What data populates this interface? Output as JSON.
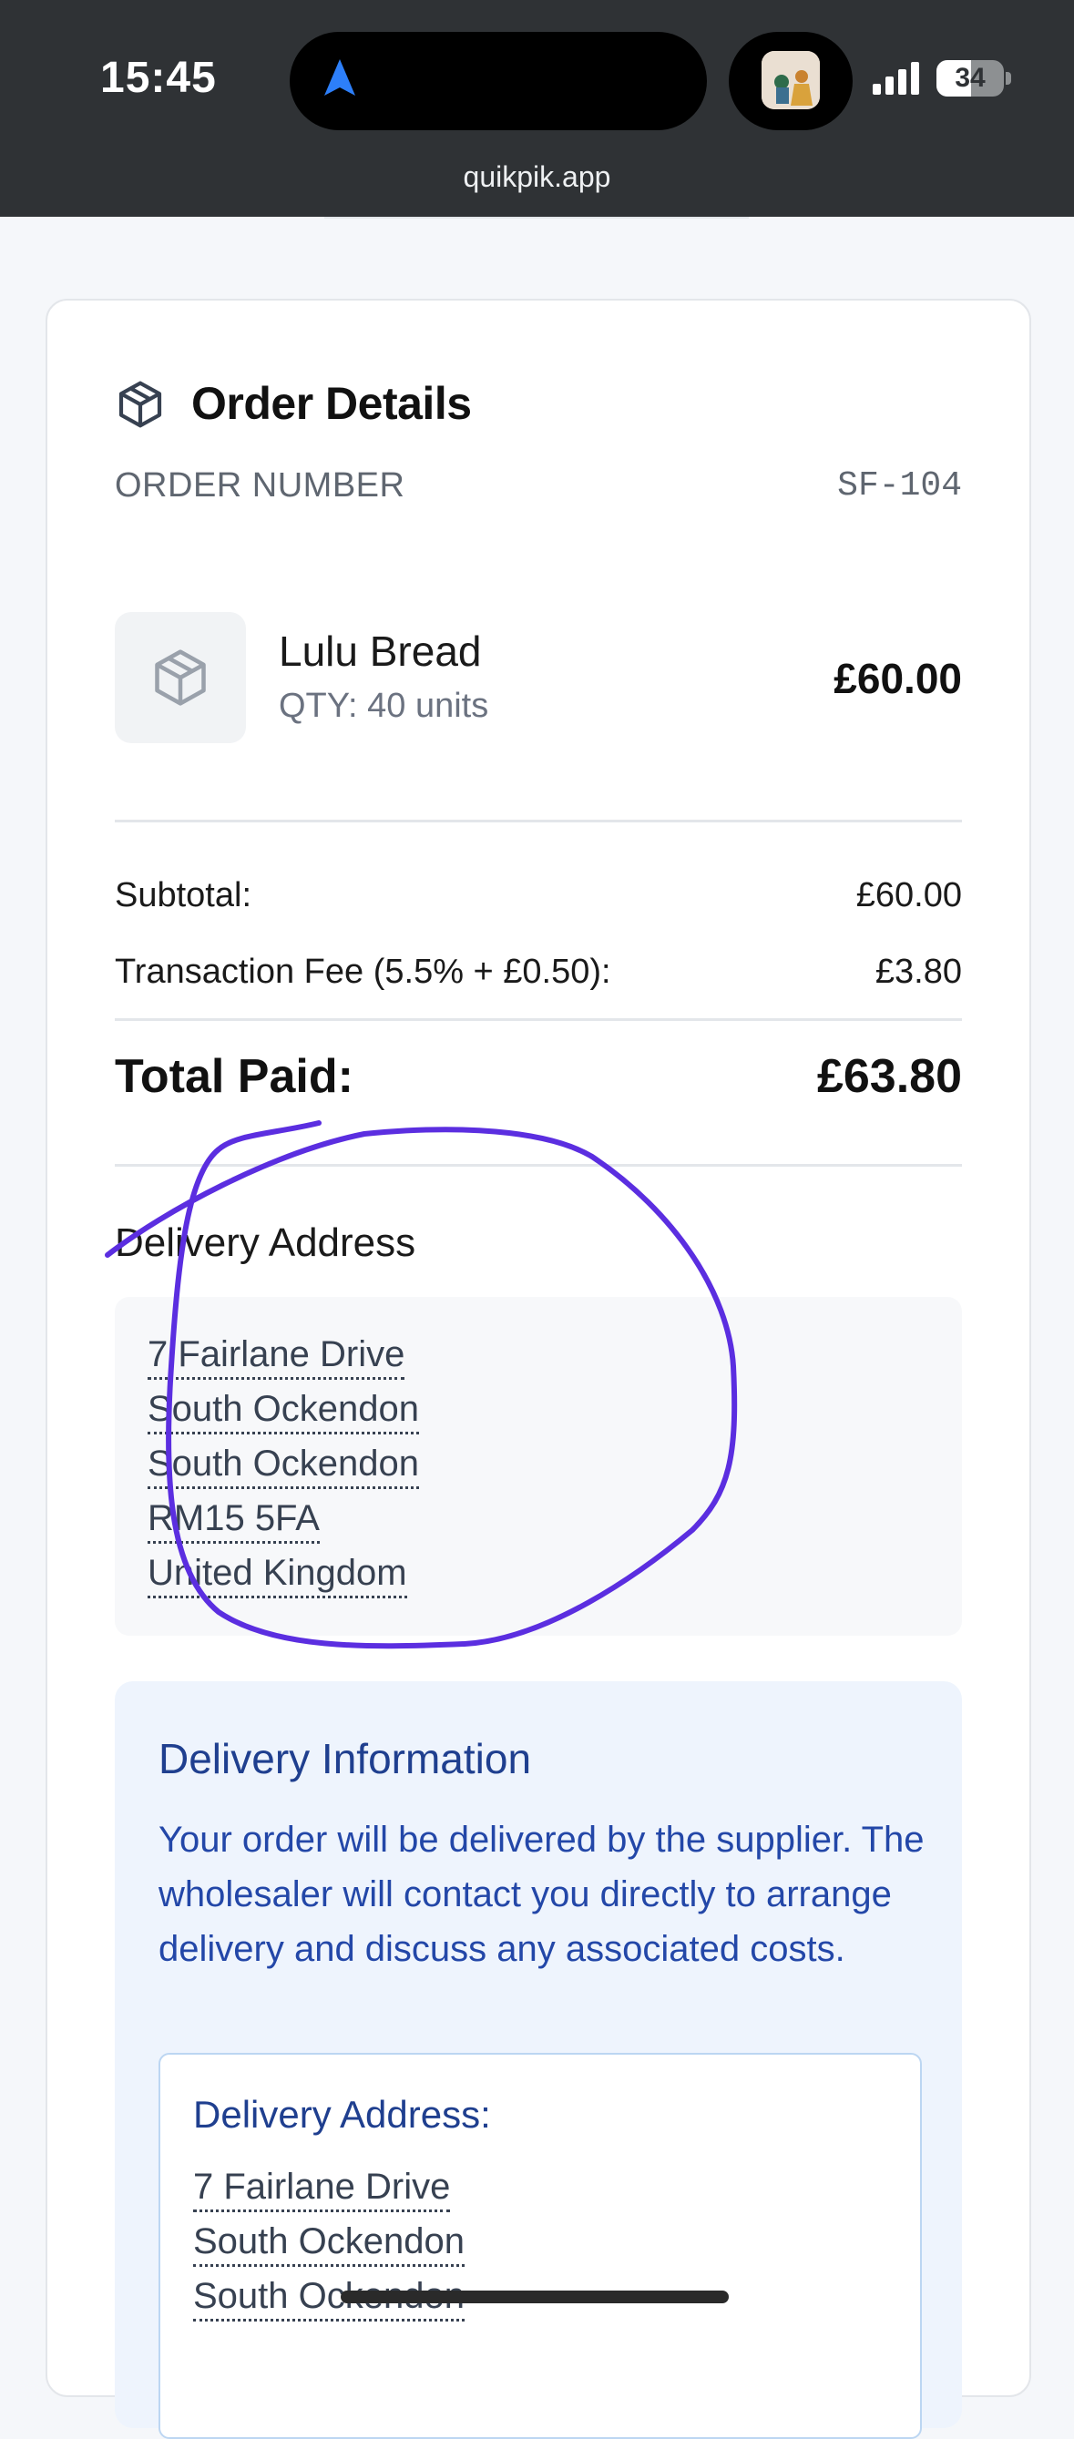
{
  "status_bar": {
    "time": "15:45",
    "battery": "34",
    "url": "quikpik.app"
  },
  "order": {
    "title": "Order Details",
    "order_number_label": "ORDER NUMBER",
    "order_number": "SF-104",
    "item": {
      "name": "Lulu Bread",
      "qty": "QTY: 40 units",
      "price": "£60.00"
    },
    "subtotal_label": "Subtotal:",
    "subtotal": "£60.00",
    "fee_label": "Transaction Fee (5.5% + £0.50):",
    "fee": "£3.80",
    "total_label": "Total Paid:",
    "total": "£63.80"
  },
  "delivery_address": {
    "heading": "Delivery Address",
    "lines": [
      "7 Fairlane Drive",
      "South Ockendon",
      "South Ockendon",
      "RM15 5FA",
      "United Kingdom"
    ]
  },
  "delivery_info": {
    "title": "Delivery Information",
    "text": "Your order will be delivered by the supplier. The wholesaler will contact you directly to arrange delivery and discuss any associated costs.",
    "address_heading": "Delivery Address:",
    "address_lines": [
      "7 Fairlane Drive",
      "South Ockendon",
      "South Ockendon"
    ]
  },
  "colors": {
    "accent_blue": "#2347a8",
    "annotation_purple": "#5b2ee0",
    "status_bar": "#2f3235"
  },
  "icons": {
    "title_icon": "package-icon",
    "product_icon": "package-icon",
    "nav_icon": "navigation-arrow-icon"
  }
}
